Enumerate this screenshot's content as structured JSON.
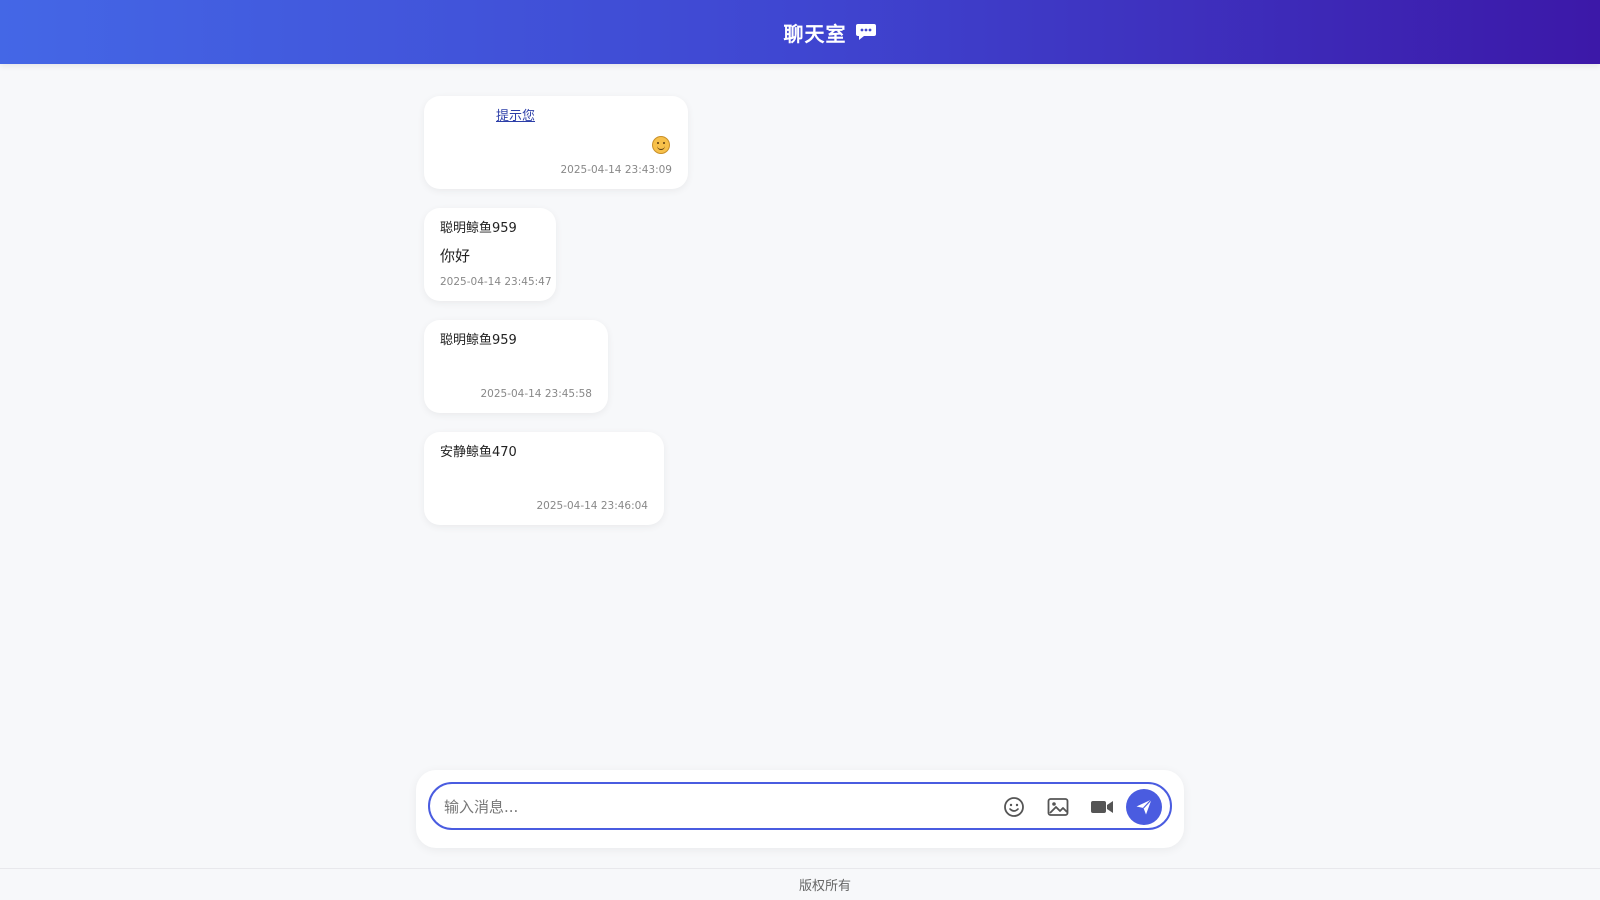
{
  "header": {
    "title": "聊天室",
    "icon": "chat-bubble-icon"
  },
  "messages": [
    {
      "user": "提示您",
      "text": "",
      "time": "2025-04-14 23:43:09",
      "emoji": "smile-emoji-icon"
    },
    {
      "user": "聪明鲸鱼959",
      "text": "你好",
      "time": "2025-04-14 23:45:47"
    },
    {
      "user": "聪明鲸鱼959",
      "text": "",
      "time": "2025-04-14 23:45:58"
    },
    {
      "user": "安静鲸鱼470",
      "text": "",
      "time": "2025-04-14 23:46:04"
    }
  ],
  "composer": {
    "placeholder": "输入消息...",
    "tools": [
      "emoji-icon",
      "image-icon",
      "video-icon"
    ],
    "send_icon": "send-icon",
    "accent": "#4a5ce0"
  },
  "footer": {
    "text": "版权所有"
  },
  "colors": {
    "header_start": "#4467e6",
    "header_end": "#3c18a8",
    "background": "#f7f8fa"
  }
}
